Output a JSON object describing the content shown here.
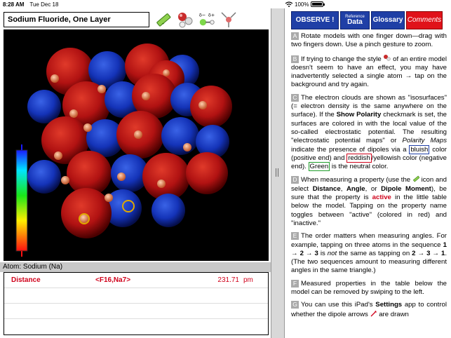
{
  "statusbar": {
    "time": "8:28 AM",
    "date": "Tue Dec 18",
    "battery": "100%"
  },
  "left": {
    "title": "Sodium Fluoride, One Layer",
    "tools": [
      "ruler-icon",
      "molecule-style-icon",
      "dipole-icon",
      "pin-icon"
    ],
    "atom_label": "Atom: Sodium (Na)",
    "properties": [
      {
        "name": "Distance",
        "atoms": "<F16,Na7>",
        "value": "231.71",
        "unit": "pm"
      }
    ]
  },
  "right": {
    "buttons": {
      "observe": "OBSERVE !",
      "reference_small": "Reference",
      "reference": "Data",
      "glossary": "Glossary",
      "comments": "Comments"
    },
    "notes": {
      "A": {
        "letter": "A",
        "text": "Rotate models with one finger down—drag with two fingers down. Use a pinch gesture to zoom."
      },
      "B": {
        "letter": "B",
        "t1": "If trying to change the style",
        "t2": "of an entire model doesn't seem to have an effect, you may have inadvertently selected a single atom → tap on the background and try again."
      },
      "C": {
        "letter": "C",
        "t1": "The electron clouds are shown as \"isosurfaces\" (= electron density is the same anywhere on the surface). If the",
        "b1": "Show Polarity",
        "t2": "checkmark is set, the surfaces are colored in with the local value of the so-called electrostatic potential. The resulting \"electrostatic potential maps\" or",
        "i1": "Polarity Maps",
        "t3": "indicate the presence of dipoles via a",
        "bluish": "bluish",
        "t4": "color (positive end) and",
        "reddish": "reddish",
        "t5": "/yellowish color (negative end).",
        "green": "Green",
        "t6": "is the neutral color."
      },
      "D": {
        "letter": "D",
        "t1": "When measuring a property (use the",
        "t2": "icon and select",
        "b1": "Distance",
        "t3": ",",
        "b2": "Angle",
        "t4": ", or",
        "b3": "Dipole Moment",
        "t5": "), be sure that the property is",
        "active": "active",
        "t6": "in the little table below the model. Tapping on the property name toggles between \"active\" (colored in red) and \"inactive.\""
      },
      "E": {
        "letter": "E",
        "t1": "The order matters when measuring angles. For example, tapping on three atoms in the sequence",
        "s1": "1 → 2 → 3",
        "t2": "is",
        "i1": "not",
        "t3": "the same as tapping on",
        "s2": "2 → 3 → 1",
        "t4": ". (The two sequences amount to measuring different angles in the same triangle.)"
      },
      "F": {
        "letter": "F",
        "text": "Measured properties in the table below the model can be removed by swiping to the left."
      },
      "G": {
        "letter": "G",
        "t1": "You can use this iPad's",
        "b1": "Settings",
        "t2": "app to control whether the dipole arrows",
        "t3": "are drawn"
      }
    }
  },
  "colors": {
    "accent": "#1f3fa6",
    "comments": "#e0121a",
    "active": "#d0021b"
  }
}
